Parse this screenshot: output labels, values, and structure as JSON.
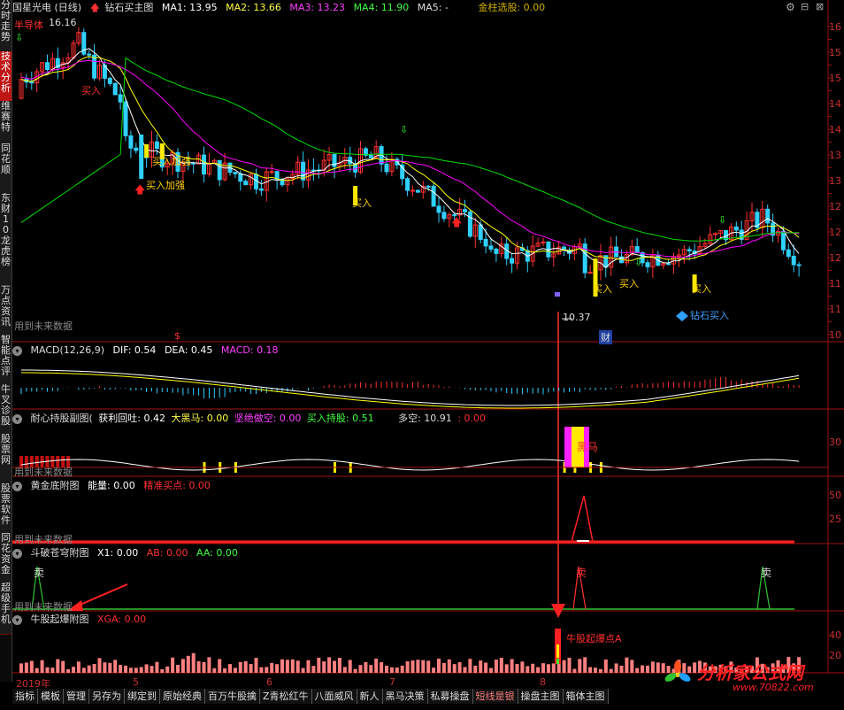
{
  "side_tabs": [
    "分时走势",
    "技术分析",
    "维赛特",
    "同花顺",
    "东财10",
    "龙虎榜",
    "万点资讯",
    "智能点评",
    "牛叉诊股",
    "股票网",
    "股票软件",
    "同花资金",
    "超级手机"
  ],
  "main": {
    "stock_name": "国星光电 (日线)",
    "indicator": "钻石买主图",
    "ma1": "MA1: 13.95",
    "ma2": "MA2: 13.66",
    "ma3": "MA3: 13.23",
    "ma4": "MA4: 11.90",
    "ma5": "MA5: -",
    "pick": "金柱选股: 0.00",
    "high_label": "16.16",
    "half_label": "半导体",
    "low_label": "10.37",
    "buy1": "买入",
    "buy_add": "买入加强",
    "buy_add2": "买入加强",
    "buy2": "买入",
    "buy3": "买入",
    "buy4": "买入",
    "buy5": "买入",
    "diamond_buy": "钻石买入",
    "dollar": "$",
    "cai": "财",
    "future": "用到未来数据",
    "yaxis": [
      "16",
      "15",
      "15",
      "14",
      "14",
      "13",
      "13",
      "12",
      "12",
      "12",
      "11",
      "11",
      "10"
    ]
  },
  "macd": {
    "title": "MACD(12,26,9)",
    "dif": "DIF: 0.54",
    "dea": "DEA: 0.45",
    "macd": "MACD: 0.18"
  },
  "naixin": {
    "title": "耐心持股副图(",
    "a": "获利回吐: 0.42",
    "b": "大黑马: 0.00",
    "c": "坚绝做空: 0.00",
    "d": "买入持股: 0.51",
    "e": "多空: 10.91",
    "f": ": 0.00",
    "label": "黑马",
    "y30": "30",
    "future": "用到未来数据"
  },
  "gold": {
    "title": "黄金底附图",
    "a": "能量: 0.00",
    "b": "精准买点: 0.00",
    "y50": "50",
    "y25": "25",
    "future": "用到未来数据"
  },
  "dou": {
    "title": "斗破苍穹附图",
    "a": "X1: 0.00",
    "b": "AB: 0.00",
    "c": "AA: 0.00",
    "sell1": "卖",
    "sell2": "卖",
    "sell3": "卖",
    "future": "用到未来数据"
  },
  "niu": {
    "title": "牛股起爆附图",
    "a": "XGA: 0.00",
    "label": "牛股起爆点A",
    "y40": "40",
    "y20": "20"
  },
  "xaxis": [
    "2019年",
    "5",
    "6",
    "7",
    "8"
  ],
  "bottom_tabs": [
    "指标",
    "模板",
    "管理",
    "另存为",
    "绑定到",
    "原始经典",
    "百万牛股擒",
    "Z青松红牛",
    "八面威风",
    "新人",
    "黑马决策",
    "私募操盘",
    "短线是银",
    "操盘主图",
    "箱体主图"
  ],
  "watermark": {
    "text": "分析家公式网",
    "url": "www.70822.com"
  },
  "colors": {
    "ma1": "#ffffff",
    "ma2": "#ffff00",
    "ma3": "#ff00ff",
    "ma4": "#00ff00",
    "up": "#ff3030",
    "down": "#30d0ff",
    "panel_border": "#a01010",
    "accent": "#ff2020"
  }
}
